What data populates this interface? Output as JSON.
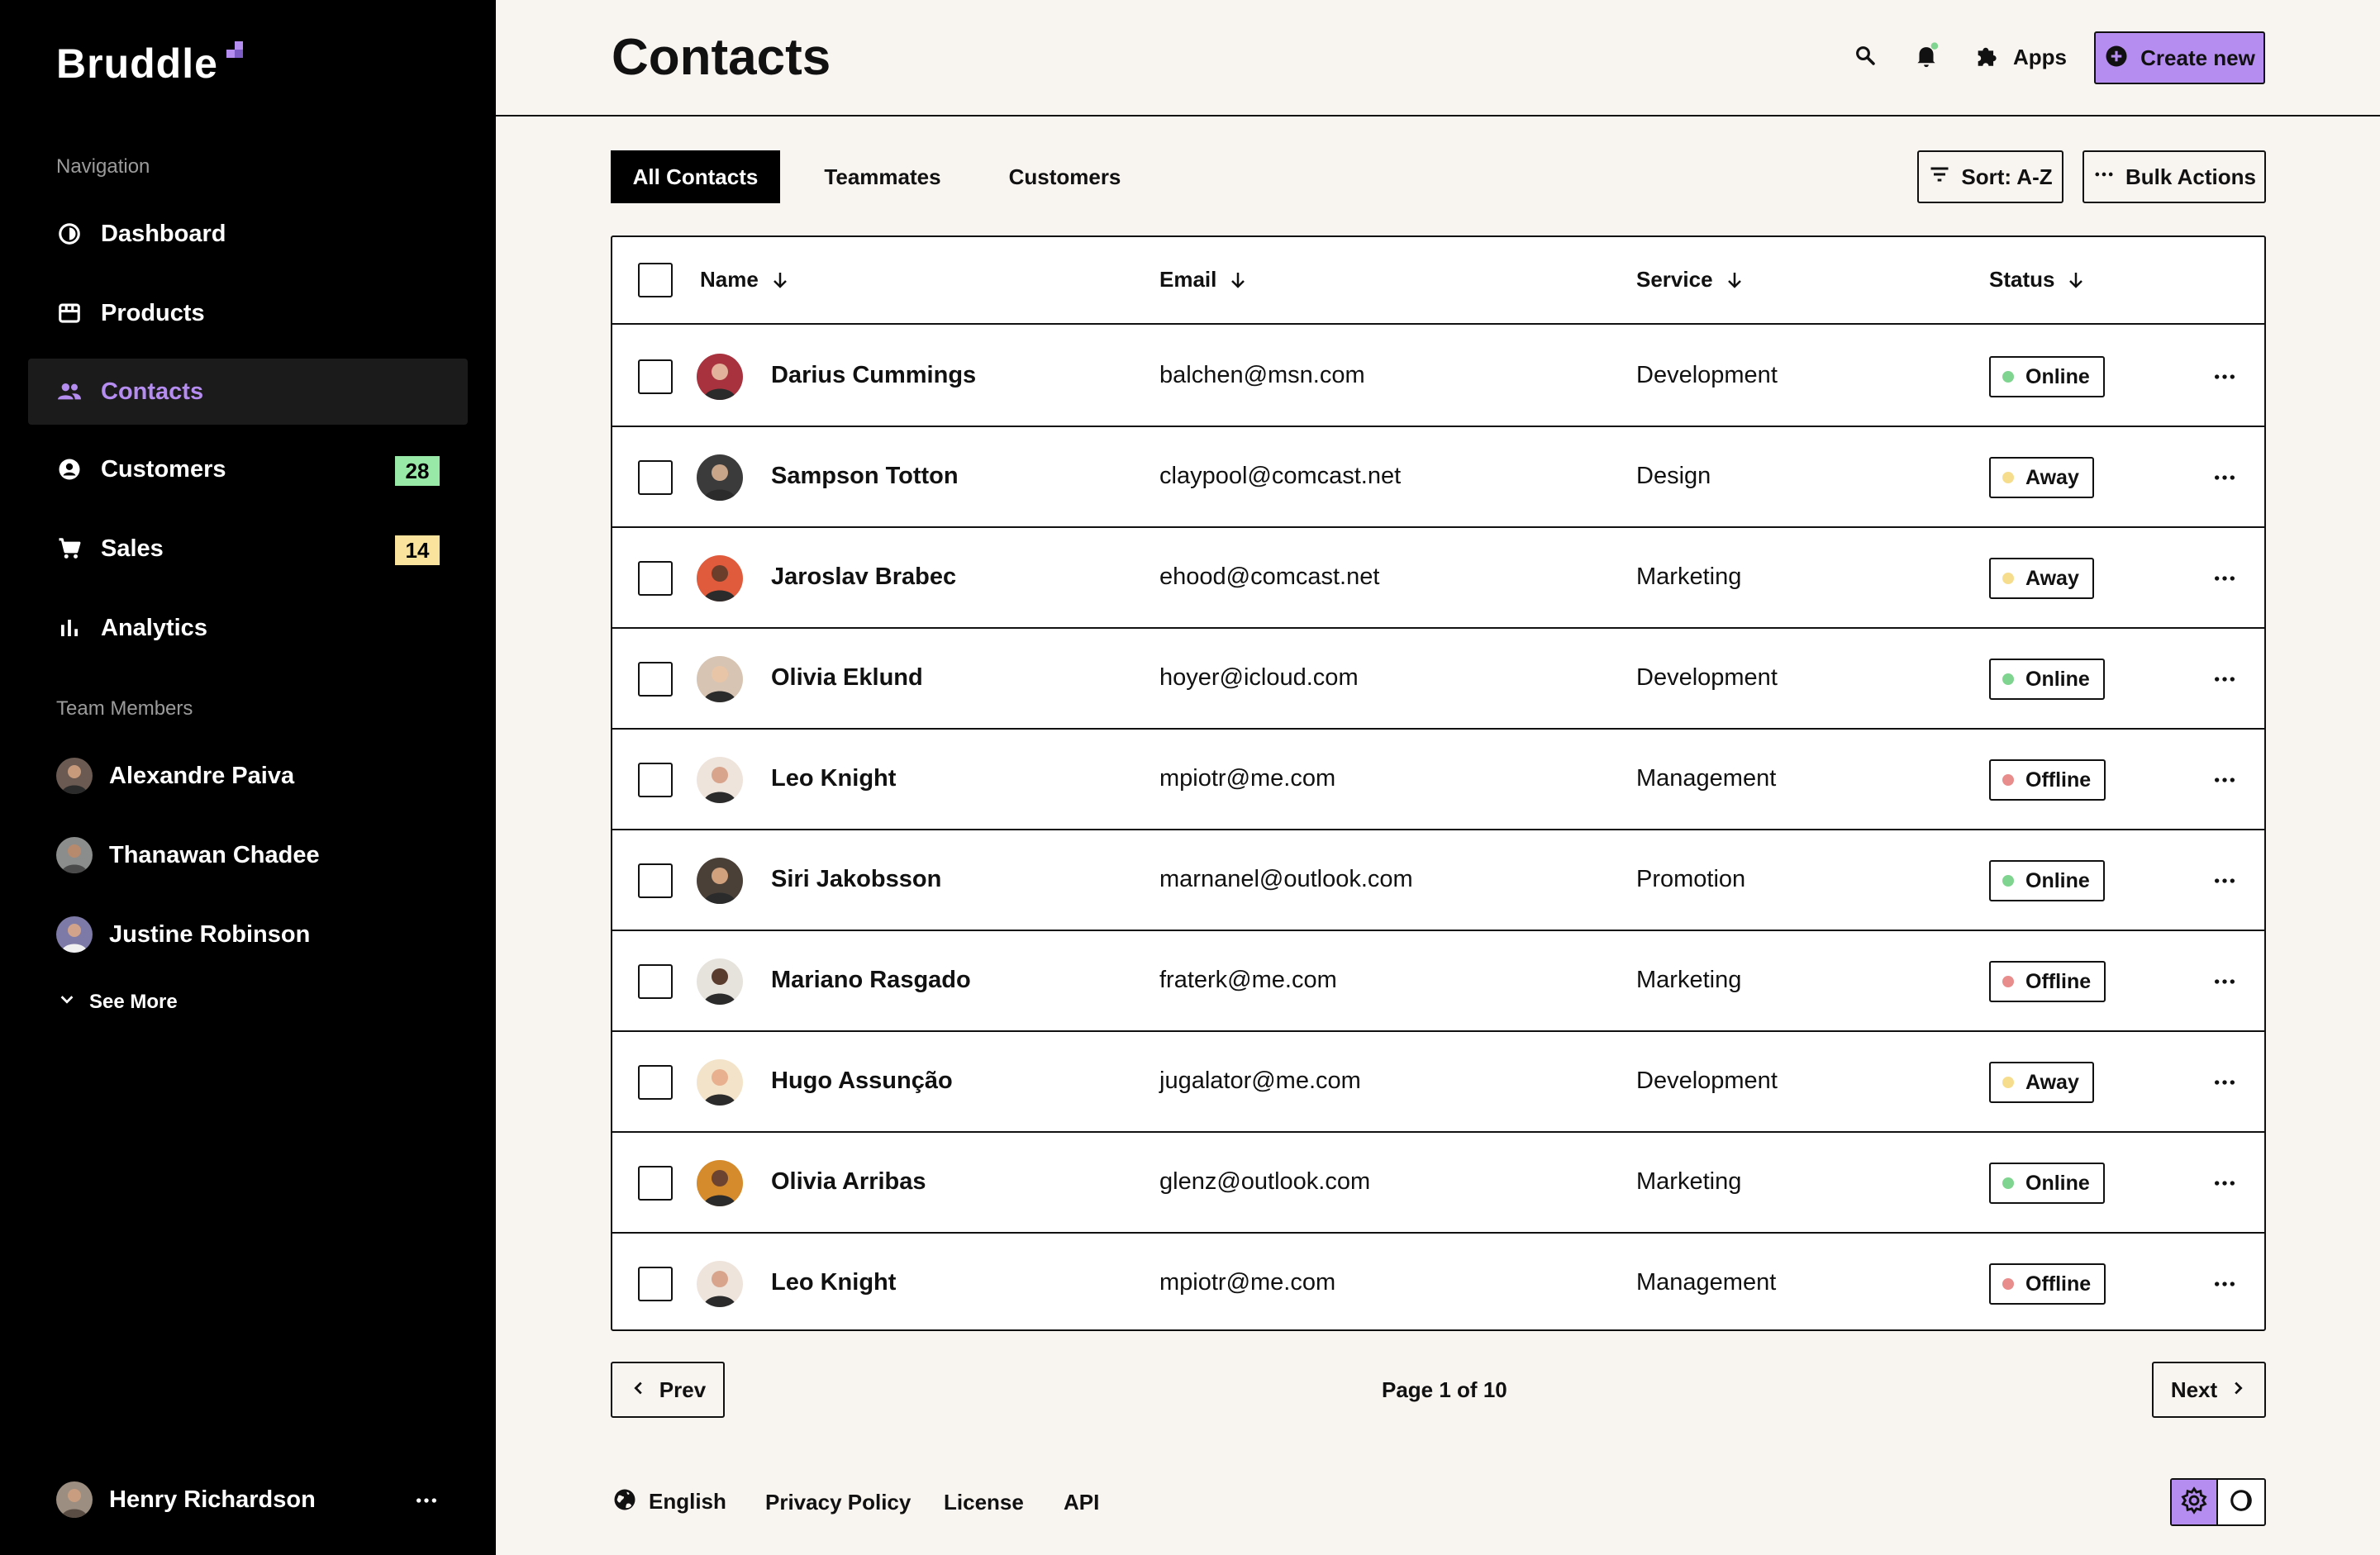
{
  "app": {
    "name": "Bruddle"
  },
  "sidebar": {
    "nav_label": "Navigation",
    "items": [
      {
        "label": "Dashboard",
        "icon": "dashboard-icon",
        "badge": null
      },
      {
        "label": "Products",
        "icon": "products-icon",
        "badge": null
      },
      {
        "label": "Contacts",
        "icon": "contacts-icon",
        "badge": null,
        "active": true
      },
      {
        "label": "Customers",
        "icon": "customers-icon",
        "badge": "28",
        "badge_color": "#98e9a8"
      },
      {
        "label": "Sales",
        "icon": "cart-icon",
        "badge": "14",
        "badge_color": "#fae39c"
      },
      {
        "label": "Analytics",
        "icon": "analytics-icon",
        "badge": null
      }
    ],
    "team_label": "Team Members",
    "members": [
      "Alexandre Paiva",
      "Thanawan Chadee",
      "Justine Robinson"
    ],
    "see_more": "See More",
    "user": {
      "name": "Henry Richardson"
    }
  },
  "header": {
    "title": "Contacts",
    "apps_label": "Apps",
    "create_label": "Create new"
  },
  "tabs": [
    "All Contacts",
    "Teammates",
    "Customers"
  ],
  "toolbar": {
    "sort_label": "Sort: A-Z",
    "bulk_label": "Bulk Actions"
  },
  "table": {
    "columns": [
      "Name",
      "Email",
      "Service",
      "Status"
    ],
    "rows": [
      {
        "name": "Darius Cummings",
        "email": "balchen@msn.com",
        "service": "Development",
        "status": "Online"
      },
      {
        "name": "Sampson Totton",
        "email": "claypool@comcast.net",
        "service": "Design",
        "status": "Away"
      },
      {
        "name": "Jaroslav Brabec",
        "email": "ehood@comcast.net",
        "service": "Marketing",
        "status": "Away"
      },
      {
        "name": "Olivia Eklund",
        "email": "hoyer@icloud.com",
        "service": "Development",
        "status": "Online"
      },
      {
        "name": "Leo Knight",
        "email": "mpiotr@me.com",
        "service": "Management",
        "status": "Offline"
      },
      {
        "name": "Siri Jakobsson",
        "email": "marnanel@outlook.com",
        "service": "Promotion",
        "status": "Online"
      },
      {
        "name": "Mariano Rasgado",
        "email": "fraterk@me.com",
        "service": "Marketing",
        "status": "Offline"
      },
      {
        "name": "Hugo Assunção",
        "email": "jugalator@me.com",
        "service": "Development",
        "status": "Away"
      },
      {
        "name": "Olivia Arribas",
        "email": "glenz@outlook.com",
        "service": "Marketing",
        "status": "Online"
      },
      {
        "name": "Leo Knight",
        "email": "mpiotr@me.com",
        "service": "Management",
        "status": "Offline"
      }
    ]
  },
  "status_colors": {
    "Online": "#7fd48f",
    "Away": "#f6dd8e",
    "Offline": "#e88c8c"
  },
  "pagination": {
    "prev": "Prev",
    "next": "Next",
    "info": "Page 1 of 10"
  },
  "footer": {
    "language": "English",
    "links": [
      "Privacy Policy",
      "License",
      "API"
    ]
  },
  "colors": {
    "accent": "#b58cf0",
    "background": "#f8f4f0",
    "sidebar": "#000000"
  }
}
